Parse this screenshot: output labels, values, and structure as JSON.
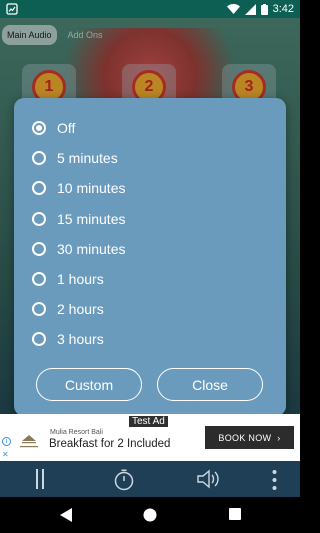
{
  "status_bar": {
    "time": "3:42"
  },
  "tabs": {
    "main": "Main Audio",
    "addons": "Add Ons"
  },
  "sound_tiles": [
    "1",
    "2",
    "3"
  ],
  "timer_dialog": {
    "options": [
      "Off",
      "5 minutes",
      "10 minutes",
      "15 minutes",
      "30 minutes",
      "1 hours",
      "2 hours",
      "3 hours"
    ],
    "selected_index": 0,
    "custom_label": "Custom",
    "close_label": "Close"
  },
  "ad": {
    "badge": "Test Ad",
    "sponsor": "Mulia Resort Bali",
    "headline": "Breakfast for 2 Included",
    "cta": "BOOK NOW"
  },
  "colors": {
    "dialog_bg": "#6a9bbd",
    "status_bar": "#0c5f52",
    "controls_bar": "#1f3f57"
  }
}
